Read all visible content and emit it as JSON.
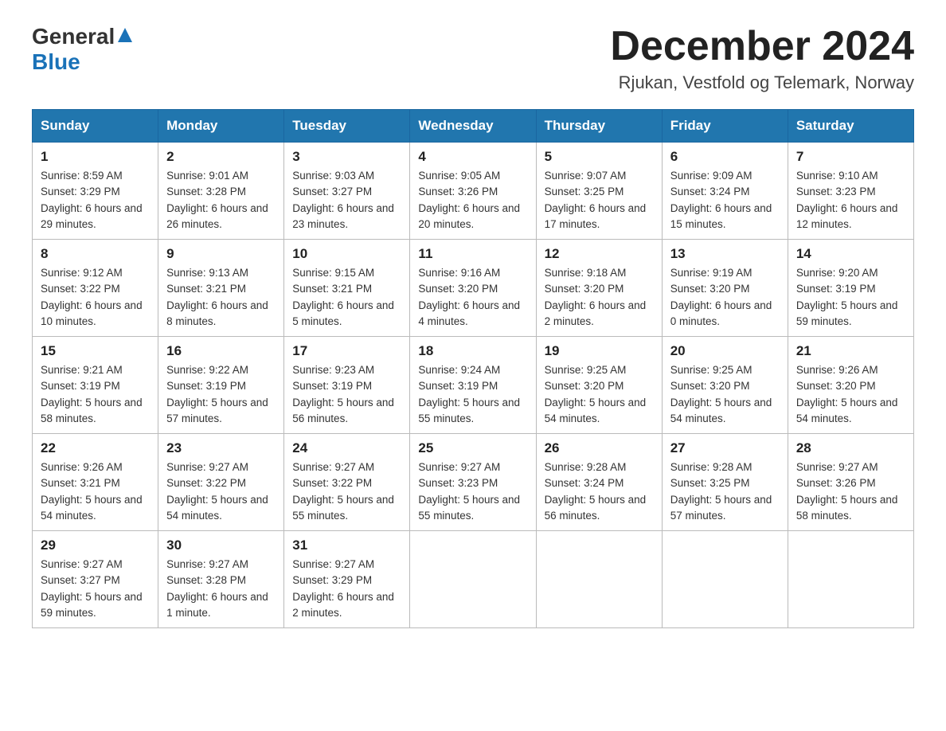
{
  "header": {
    "logo_general": "General",
    "logo_blue": "Blue",
    "month_title": "December 2024",
    "location": "Rjukan, Vestfold og Telemark, Norway"
  },
  "weekdays": [
    "Sunday",
    "Monday",
    "Tuesday",
    "Wednesday",
    "Thursday",
    "Friday",
    "Saturday"
  ],
  "weeks": [
    [
      {
        "day": "1",
        "sunrise": "8:59 AM",
        "sunset": "3:29 PM",
        "daylight": "6 hours and 29 minutes."
      },
      {
        "day": "2",
        "sunrise": "9:01 AM",
        "sunset": "3:28 PM",
        "daylight": "6 hours and 26 minutes."
      },
      {
        "day": "3",
        "sunrise": "9:03 AM",
        "sunset": "3:27 PM",
        "daylight": "6 hours and 23 minutes."
      },
      {
        "day": "4",
        "sunrise": "9:05 AM",
        "sunset": "3:26 PM",
        "daylight": "6 hours and 20 minutes."
      },
      {
        "day": "5",
        "sunrise": "9:07 AM",
        "sunset": "3:25 PM",
        "daylight": "6 hours and 17 minutes."
      },
      {
        "day": "6",
        "sunrise": "9:09 AM",
        "sunset": "3:24 PM",
        "daylight": "6 hours and 15 minutes."
      },
      {
        "day": "7",
        "sunrise": "9:10 AM",
        "sunset": "3:23 PM",
        "daylight": "6 hours and 12 minutes."
      }
    ],
    [
      {
        "day": "8",
        "sunrise": "9:12 AM",
        "sunset": "3:22 PM",
        "daylight": "6 hours and 10 minutes."
      },
      {
        "day": "9",
        "sunrise": "9:13 AM",
        "sunset": "3:21 PM",
        "daylight": "6 hours and 8 minutes."
      },
      {
        "day": "10",
        "sunrise": "9:15 AM",
        "sunset": "3:21 PM",
        "daylight": "6 hours and 5 minutes."
      },
      {
        "day": "11",
        "sunrise": "9:16 AM",
        "sunset": "3:20 PM",
        "daylight": "6 hours and 4 minutes."
      },
      {
        "day": "12",
        "sunrise": "9:18 AM",
        "sunset": "3:20 PM",
        "daylight": "6 hours and 2 minutes."
      },
      {
        "day": "13",
        "sunrise": "9:19 AM",
        "sunset": "3:20 PM",
        "daylight": "6 hours and 0 minutes."
      },
      {
        "day": "14",
        "sunrise": "9:20 AM",
        "sunset": "3:19 PM",
        "daylight": "5 hours and 59 minutes."
      }
    ],
    [
      {
        "day": "15",
        "sunrise": "9:21 AM",
        "sunset": "3:19 PM",
        "daylight": "5 hours and 58 minutes."
      },
      {
        "day": "16",
        "sunrise": "9:22 AM",
        "sunset": "3:19 PM",
        "daylight": "5 hours and 57 minutes."
      },
      {
        "day": "17",
        "sunrise": "9:23 AM",
        "sunset": "3:19 PM",
        "daylight": "5 hours and 56 minutes."
      },
      {
        "day": "18",
        "sunrise": "9:24 AM",
        "sunset": "3:19 PM",
        "daylight": "5 hours and 55 minutes."
      },
      {
        "day": "19",
        "sunrise": "9:25 AM",
        "sunset": "3:20 PM",
        "daylight": "5 hours and 54 minutes."
      },
      {
        "day": "20",
        "sunrise": "9:25 AM",
        "sunset": "3:20 PM",
        "daylight": "5 hours and 54 minutes."
      },
      {
        "day": "21",
        "sunrise": "9:26 AM",
        "sunset": "3:20 PM",
        "daylight": "5 hours and 54 minutes."
      }
    ],
    [
      {
        "day": "22",
        "sunrise": "9:26 AM",
        "sunset": "3:21 PM",
        "daylight": "5 hours and 54 minutes."
      },
      {
        "day": "23",
        "sunrise": "9:27 AM",
        "sunset": "3:22 PM",
        "daylight": "5 hours and 54 minutes."
      },
      {
        "day": "24",
        "sunrise": "9:27 AM",
        "sunset": "3:22 PM",
        "daylight": "5 hours and 55 minutes."
      },
      {
        "day": "25",
        "sunrise": "9:27 AM",
        "sunset": "3:23 PM",
        "daylight": "5 hours and 55 minutes."
      },
      {
        "day": "26",
        "sunrise": "9:28 AM",
        "sunset": "3:24 PM",
        "daylight": "5 hours and 56 minutes."
      },
      {
        "day": "27",
        "sunrise": "9:28 AM",
        "sunset": "3:25 PM",
        "daylight": "5 hours and 57 minutes."
      },
      {
        "day": "28",
        "sunrise": "9:27 AM",
        "sunset": "3:26 PM",
        "daylight": "5 hours and 58 minutes."
      }
    ],
    [
      {
        "day": "29",
        "sunrise": "9:27 AM",
        "sunset": "3:27 PM",
        "daylight": "5 hours and 59 minutes."
      },
      {
        "day": "30",
        "sunrise": "9:27 AM",
        "sunset": "3:28 PM",
        "daylight": "6 hours and 1 minute."
      },
      {
        "day": "31",
        "sunrise": "9:27 AM",
        "sunset": "3:29 PM",
        "daylight": "6 hours and 2 minutes."
      },
      null,
      null,
      null,
      null
    ]
  ]
}
